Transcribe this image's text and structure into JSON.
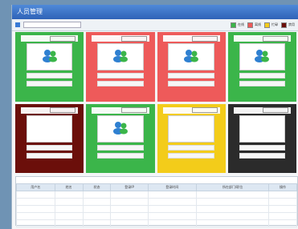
{
  "window": {
    "title": "人员管理"
  },
  "toolbar": {
    "search_placeholder": ""
  },
  "legend": [
    {
      "label": "在线",
      "color": "#3bb54a"
    },
    {
      "label": "离线",
      "color": "#ee5a5a"
    },
    {
      "label": "忙碌",
      "color": "#f3cc1a"
    },
    {
      "label": "禁用",
      "color": "#6b0f0a"
    }
  ],
  "cards": [
    {
      "color": "#3bb54a",
      "has_icon": true
    },
    {
      "color": "#ee5a5a",
      "has_icon": true
    },
    {
      "color": "#ee5a5a",
      "has_icon": true
    },
    {
      "color": "#3bb54a",
      "has_icon": true
    },
    {
      "color": "#6b0f0a",
      "has_icon": false
    },
    {
      "color": "#3bb54a",
      "has_icon": true
    },
    {
      "color": "#f3cc1a",
      "has_icon": false
    },
    {
      "color": "#2b2b2b",
      "has_icon": false
    }
  ],
  "table": {
    "headers": [
      "用户名",
      "姓名",
      "状态",
      "登录IP",
      "登录时间",
      "所在部门/职位",
      "操作"
    ],
    "rows": [
      [
        "",
        "",
        "",
        "",
        "",
        "",
        ""
      ],
      [
        "",
        "",
        "",
        "",
        "",
        "",
        ""
      ],
      [
        "",
        "",
        "",
        "",
        "",
        "",
        ""
      ],
      [
        "",
        "",
        "",
        "",
        "",
        "",
        ""
      ],
      [
        "",
        "",
        "",
        "",
        "",
        "",
        ""
      ]
    ]
  }
}
